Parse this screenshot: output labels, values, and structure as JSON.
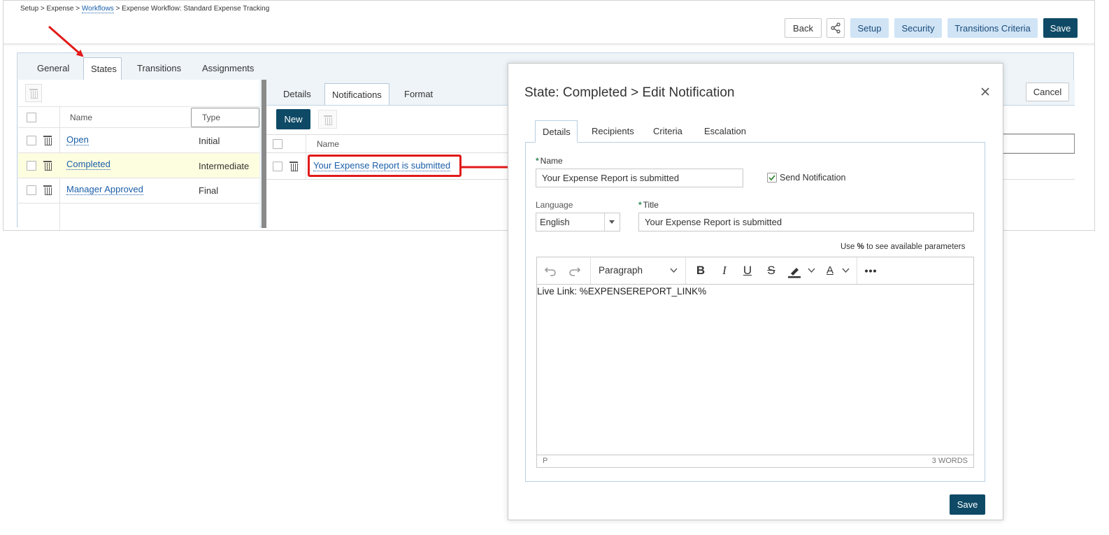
{
  "breadcrumb": {
    "setup": "Setup",
    "sep": ">",
    "expense": "Expense",
    "workflows": "Workflows",
    "workflow": "Expense Workflow: Standard Expense Tracking"
  },
  "header_buttons": {
    "back": "Back",
    "share_icon": "share-icon",
    "setup": "Setup",
    "security": "Security",
    "transitions_criteria": "Transitions Criteria",
    "save": "Save"
  },
  "main_tabs": {
    "general": "General",
    "states": "States",
    "transitions": "Transitions",
    "assignments": "Assignments"
  },
  "states_grid": {
    "col_name": "Name",
    "col_type": "Type",
    "rows": [
      {
        "name": "Open",
        "type": "Initial"
      },
      {
        "name": "Completed",
        "type": "Intermediate"
      },
      {
        "name": "Manager Approved",
        "type": "Final"
      }
    ]
  },
  "sub_tabs": {
    "details": "Details",
    "notifications": "Notifications",
    "format": "Format"
  },
  "notifications": {
    "new_button": "New",
    "col_name": "Name",
    "rows": [
      {
        "name": "Your Expense Report is submitted"
      }
    ],
    "cancel": "Cancel"
  },
  "modal": {
    "title": "State: Completed > Edit Notification",
    "tabs": {
      "details": "Details",
      "recipients": "Recipients",
      "criteria": "Criteria",
      "escalation": "Escalation"
    },
    "name_label": "Name",
    "name_value": "Your Expense Report is submitted",
    "send_notification_label": "Send Notification",
    "send_notification_checked": true,
    "language_label": "Language",
    "language_value": "English",
    "title_label": "Title",
    "title_value": "Your Expense Report is submitted",
    "hint_prefix": "Use",
    "hint_symbol": "%",
    "hint_suffix": "to see available parameters",
    "editor": {
      "block_format": "Paragraph",
      "content": "Live Link: %EXPENSEREPORT_LINK%",
      "path": "P",
      "word_count": "3 WORDS"
    },
    "save": "Save"
  },
  "colors": {
    "primary": "#0e4a66",
    "secondary_button": "#d0e4f6",
    "link": "#1a5ea8",
    "annotation_red": "#e21a1a",
    "selected_row": "#fdfde0"
  }
}
